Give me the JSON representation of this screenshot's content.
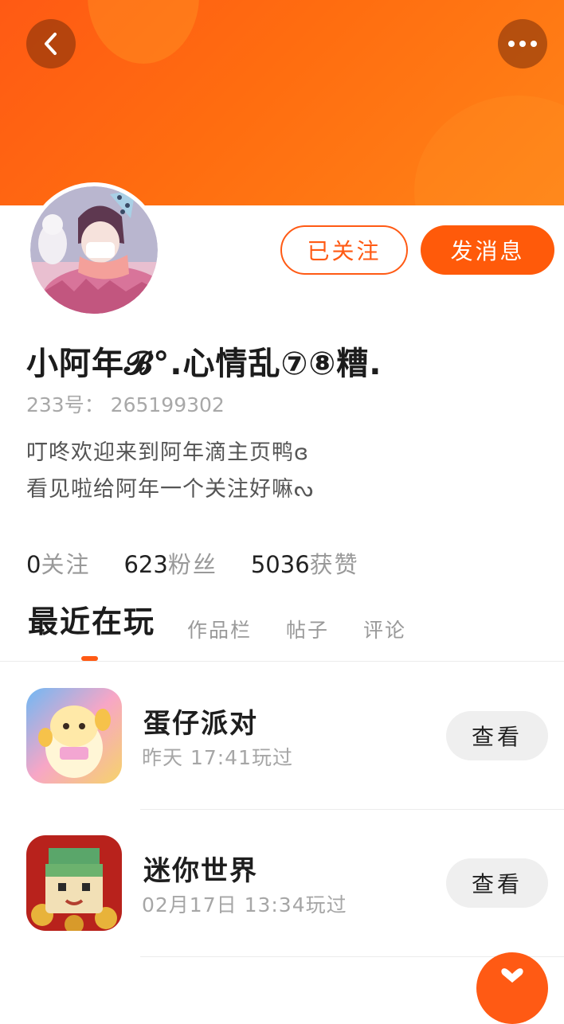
{
  "colors": {
    "accent": "#ff5a14",
    "accent_dark": "#ff5a0a",
    "muted": "#a8a8a8"
  },
  "header": {
    "back_icon": "chevron-left-icon",
    "more_icon": "more-horizontal-icon"
  },
  "profile": {
    "username": "小阿年𝓑°.心情乱⑦⑧糟.",
    "id_line": "233号： 265199302",
    "bio_line1": "叮咚欢迎来到阿年滴主页鸭ɞ",
    "bio_line2": "看见啦给阿年一个关注好嘛ᔓ",
    "followed_label": "已关注",
    "message_label": "发消息"
  },
  "stats": [
    {
      "value": "0",
      "label": "关注"
    },
    {
      "value": "623",
      "label": "粉丝"
    },
    {
      "value": "5036",
      "label": "获赞"
    }
  ],
  "tabs": [
    {
      "label": "最近在玩",
      "active": true
    },
    {
      "label": "作品栏",
      "active": false
    },
    {
      "label": "帖子",
      "active": false
    },
    {
      "label": "评论",
      "active": false
    }
  ],
  "games": [
    {
      "name": "蛋仔派对",
      "time": "昨天 17:41玩过",
      "action": "查看"
    },
    {
      "name": "迷你世界",
      "time": "02月17日 13:34玩过",
      "action": "查看"
    }
  ]
}
